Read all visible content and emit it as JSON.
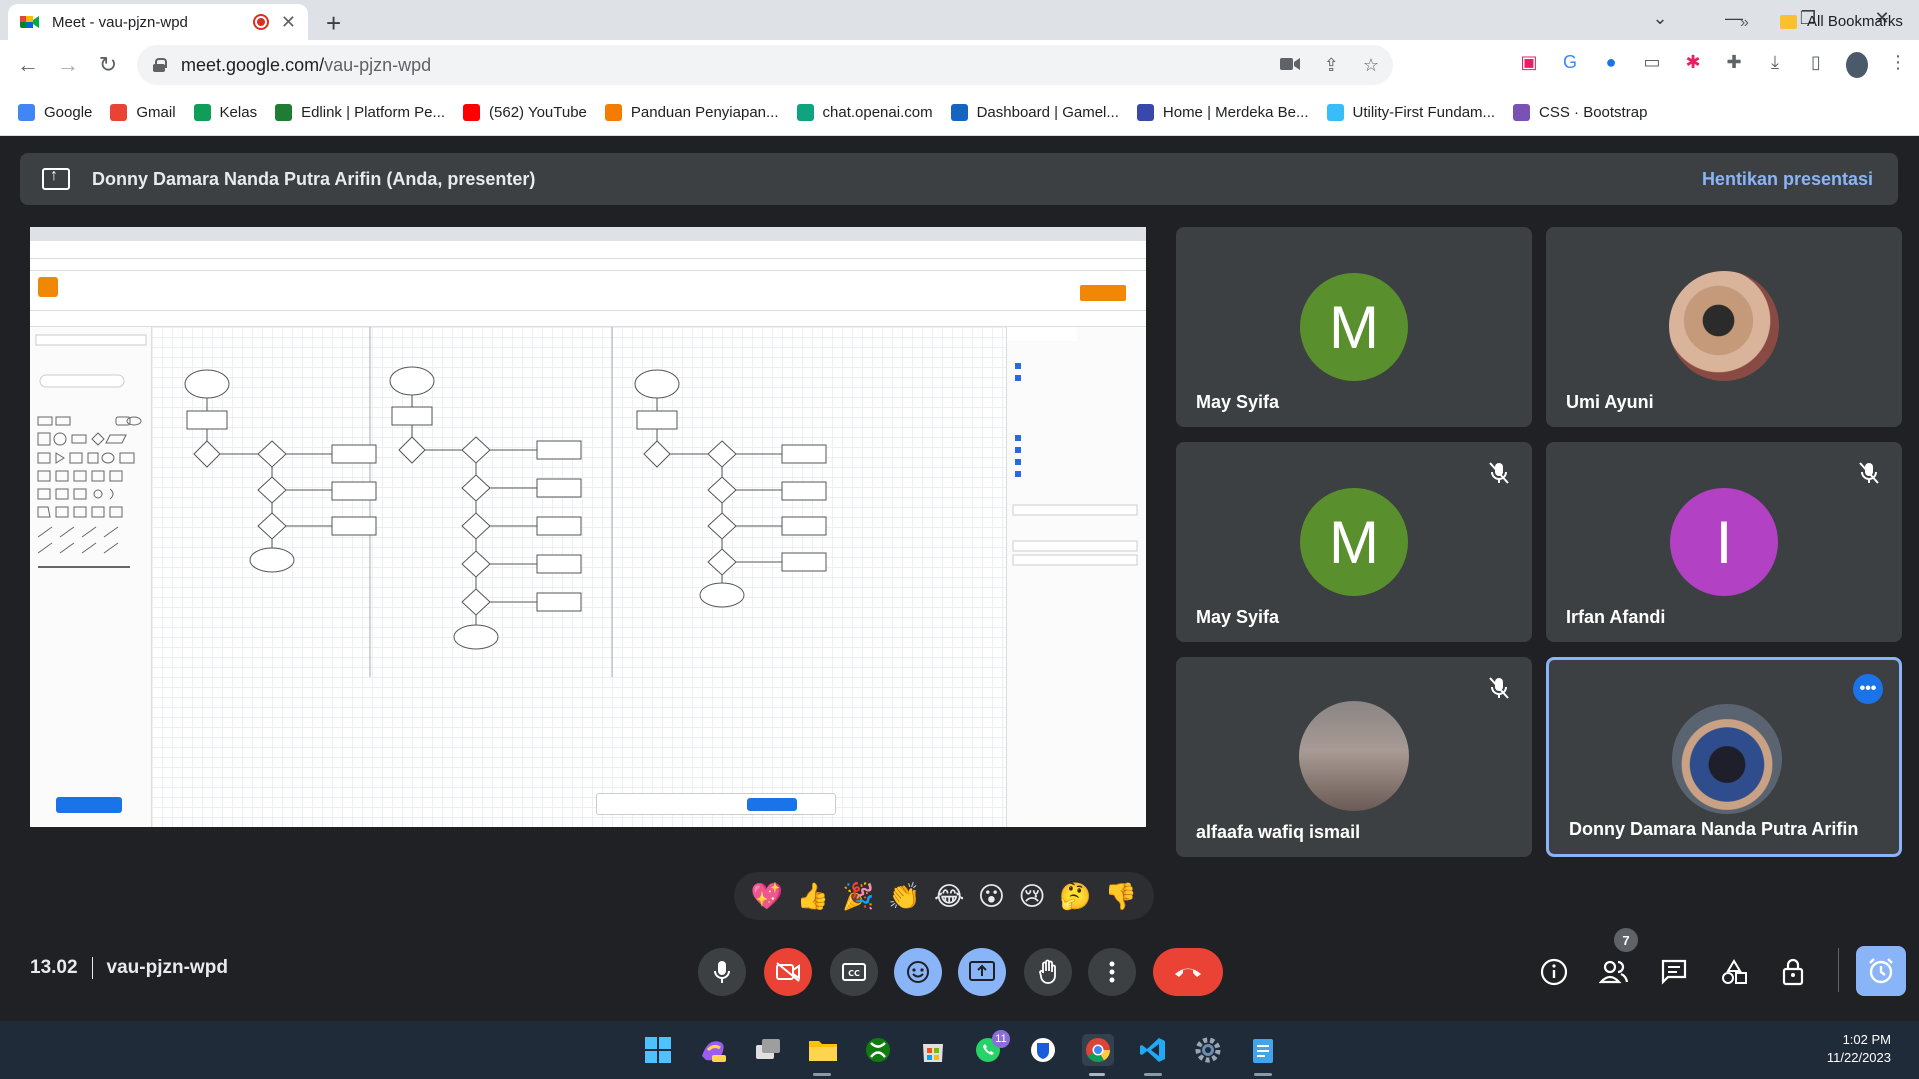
{
  "browser": {
    "tab_title": "Meet - vau-pjzn-wpd",
    "url_host": "meet.google.com/",
    "url_path": "vau-pjzn-wpd",
    "bookmarks": [
      {
        "label": "Google",
        "icon": "google-icon",
        "color": "#4285f4"
      },
      {
        "label": "Gmail",
        "icon": "gmail-icon",
        "color": "#ea4335"
      },
      {
        "label": "Kelas",
        "icon": "classroom-icon",
        "color": "#0f9d58"
      },
      {
        "label": "Edlink | Platform Pe...",
        "icon": "edlink-icon",
        "color": "#1e7d32"
      },
      {
        "label": "(562) YouTube",
        "icon": "youtube-icon",
        "color": "#ff0000"
      },
      {
        "label": "Panduan Penyiapan...",
        "icon": "panduan-icon",
        "color": "#f57c00"
      },
      {
        "label": "chat.openai.com",
        "icon": "openai-icon",
        "color": "#10a37f"
      },
      {
        "label": "Dashboard | Gamel...",
        "icon": "gamelab-icon",
        "color": "#1565c0"
      },
      {
        "label": "Home | Merdeka Be...",
        "icon": "merdeka-icon",
        "color": "#3949ab"
      },
      {
        "label": "Utility-First Fundam...",
        "icon": "tailwind-icon",
        "color": "#38bdf8"
      },
      {
        "label": "CSS · Bootstrap",
        "icon": "bootstrap-icon",
        "color": "#7952b3"
      }
    ],
    "all_bookmarks": "All Bookmarks"
  },
  "meet": {
    "presenter_banner": "Donny Damara Nanda Putra Arifin (Anda, presenter)",
    "stop_presenting": "Hentikan presentasi",
    "participants": [
      {
        "name": "May Syifa",
        "initial": "M",
        "color": "#5a8f2e",
        "muted": false,
        "kind": "initial"
      },
      {
        "name": "Umi Ayuni",
        "muted": false,
        "kind": "photo"
      },
      {
        "name": "May Syifa",
        "initial": "M",
        "color": "#5a8f2e",
        "muted": true,
        "kind": "initial"
      },
      {
        "name": "Irfan Afandi",
        "initial": "I",
        "color": "#b341c4",
        "muted": true,
        "kind": "initial"
      },
      {
        "name": "alfaafa wafiq ismail",
        "muted": true,
        "kind": "photo"
      },
      {
        "name": "Donny Damara Nanda Putra Arifin",
        "muted": false,
        "kind": "photo",
        "active": true
      }
    ],
    "reactions": [
      "💖",
      "👍",
      "🎉",
      "👏",
      "😂",
      "😮",
      "😢",
      "🤔",
      "👎"
    ],
    "time": "13.02",
    "meeting_code": "vau-pjzn-wpd",
    "people_count": "7"
  },
  "taskbar": {
    "time": "1:02 PM",
    "date": "11/22/2023",
    "whatsapp_badge": "11"
  }
}
